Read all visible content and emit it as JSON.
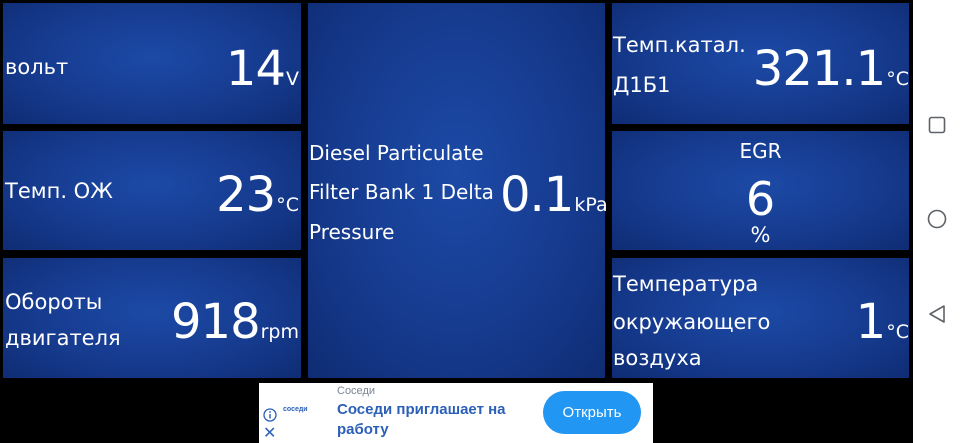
{
  "gauges": {
    "volt": {
      "label": "вольт",
      "value": "14",
      "unit": "V"
    },
    "coolant": {
      "label": "Темп. ОЖ",
      "value": "23",
      "unit": "°C"
    },
    "rpm": {
      "label1": "Обороты",
      "label2": "двигателя",
      "value": "918",
      "unit": "rpm"
    },
    "dpf": {
      "label1": "Diesel Particulate",
      "label2": "Filter Bank 1 Delta",
      "label3": "Pressure",
      "value": "0.1",
      "unit": "kPa"
    },
    "catalyst": {
      "label1": "Темп.катал.",
      "label2": "Д1Б1",
      "value": "321.1",
      "unit": "°C"
    },
    "egr": {
      "label": "EGR",
      "value": "6",
      "unit": "%"
    },
    "ambient": {
      "label1": "Температура",
      "label2": "окружающего",
      "label3": "воздуха",
      "value": "1",
      "unit": "°C"
    }
  },
  "ad": {
    "brand_small": "Соседи",
    "logo_text": "соседи",
    "line1": "Соседи приглашает на",
    "line2": "работу",
    "button": "Открыть"
  },
  "icons": {
    "recents": "square-icon",
    "home": "circle-icon",
    "back": "triangle-back-icon",
    "info": "info-icon",
    "close": "close-icon"
  },
  "colors": {
    "tile": "#163b8f",
    "ad_accent": "#2196f3"
  }
}
